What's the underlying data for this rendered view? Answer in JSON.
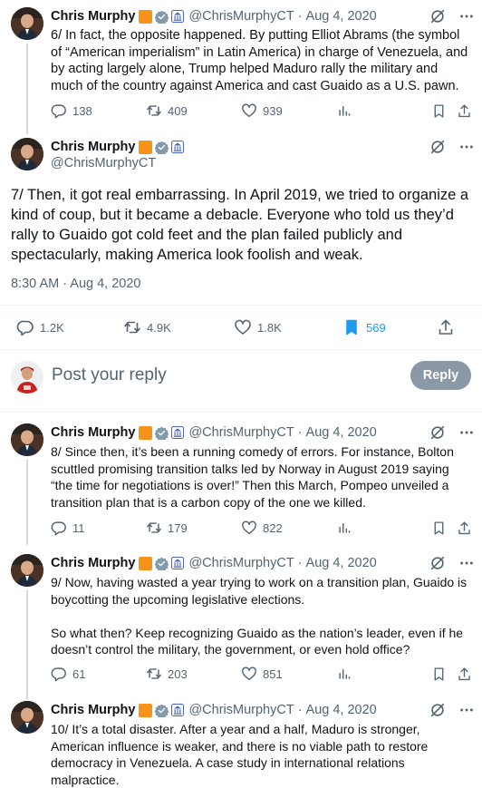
{
  "author": {
    "name": "Chris Murphy",
    "handle": "@ChrisMurphyCT"
  },
  "tweets_above": [
    {
      "date": "Aug 4, 2020",
      "text": "6/ In fact, the opposite happened. By putting Elliot Abrams (the symbol of “American imperialism” in Latin America) in charge of Venezuela, and by acting largely alone, Trump helped Maduro rally the military and much of the country against America and cast Guaido as a U.S. pawn.",
      "replies": "138",
      "reposts": "409",
      "likes": "939"
    }
  ],
  "main_tweet": {
    "text": "7/ Then, it got real embarrassing. In April 2019, we tried to organize a kind of coup, but it became a debacle. Everyone who told us they’d rally to Guaido got cold feet and the plan failed publicly and spectacularly, making America look foolish and weak.",
    "timestamp": "8:30 AM · Aug 4, 2020",
    "replies": "1.2K",
    "reposts": "4.9K",
    "likes": "1.8K",
    "bookmarks": "569"
  },
  "reply_box": {
    "placeholder": "Post your reply",
    "button_label": "Reply"
  },
  "tweets_below": [
    {
      "date": "Aug 4, 2020",
      "text": "8/ Since then, it’s been a running comedy of errors. For instance, Bolton scuttled promising transition talks led by Norway in August 2019 saying “the time for negotiations is over!” Then this March, Pompeo unveiled a transition plan that is a carbon copy of the one we killed.",
      "replies": "11",
      "reposts": "179",
      "likes": "822"
    },
    {
      "date": "Aug 4, 2020",
      "text": "9/ Now, having wasted a year trying to work on a transition plan, Guaido is boycotting the upcoming legislative elections.\n\nSo what then? Keep recognizing Guaido as the nation’s leader, even if he doesn’t control the military, the government, or even hold office?",
      "replies": "61",
      "reposts": "203",
      "likes": "851"
    },
    {
      "date": "Aug 4, 2020",
      "text": "10/ It’s a total disaster. After a year and a half, Maduro is stronger, American influence is weaker, and there is no viable path to restore democracy in Venezuela. A case study in international relations malpractice."
    }
  ],
  "colors": {
    "text": "#0f1419",
    "muted": "#536471",
    "accent_blue": "#1d9bf0",
    "org_badge": "#f7931a",
    "reply_button": "#8b98a5"
  }
}
